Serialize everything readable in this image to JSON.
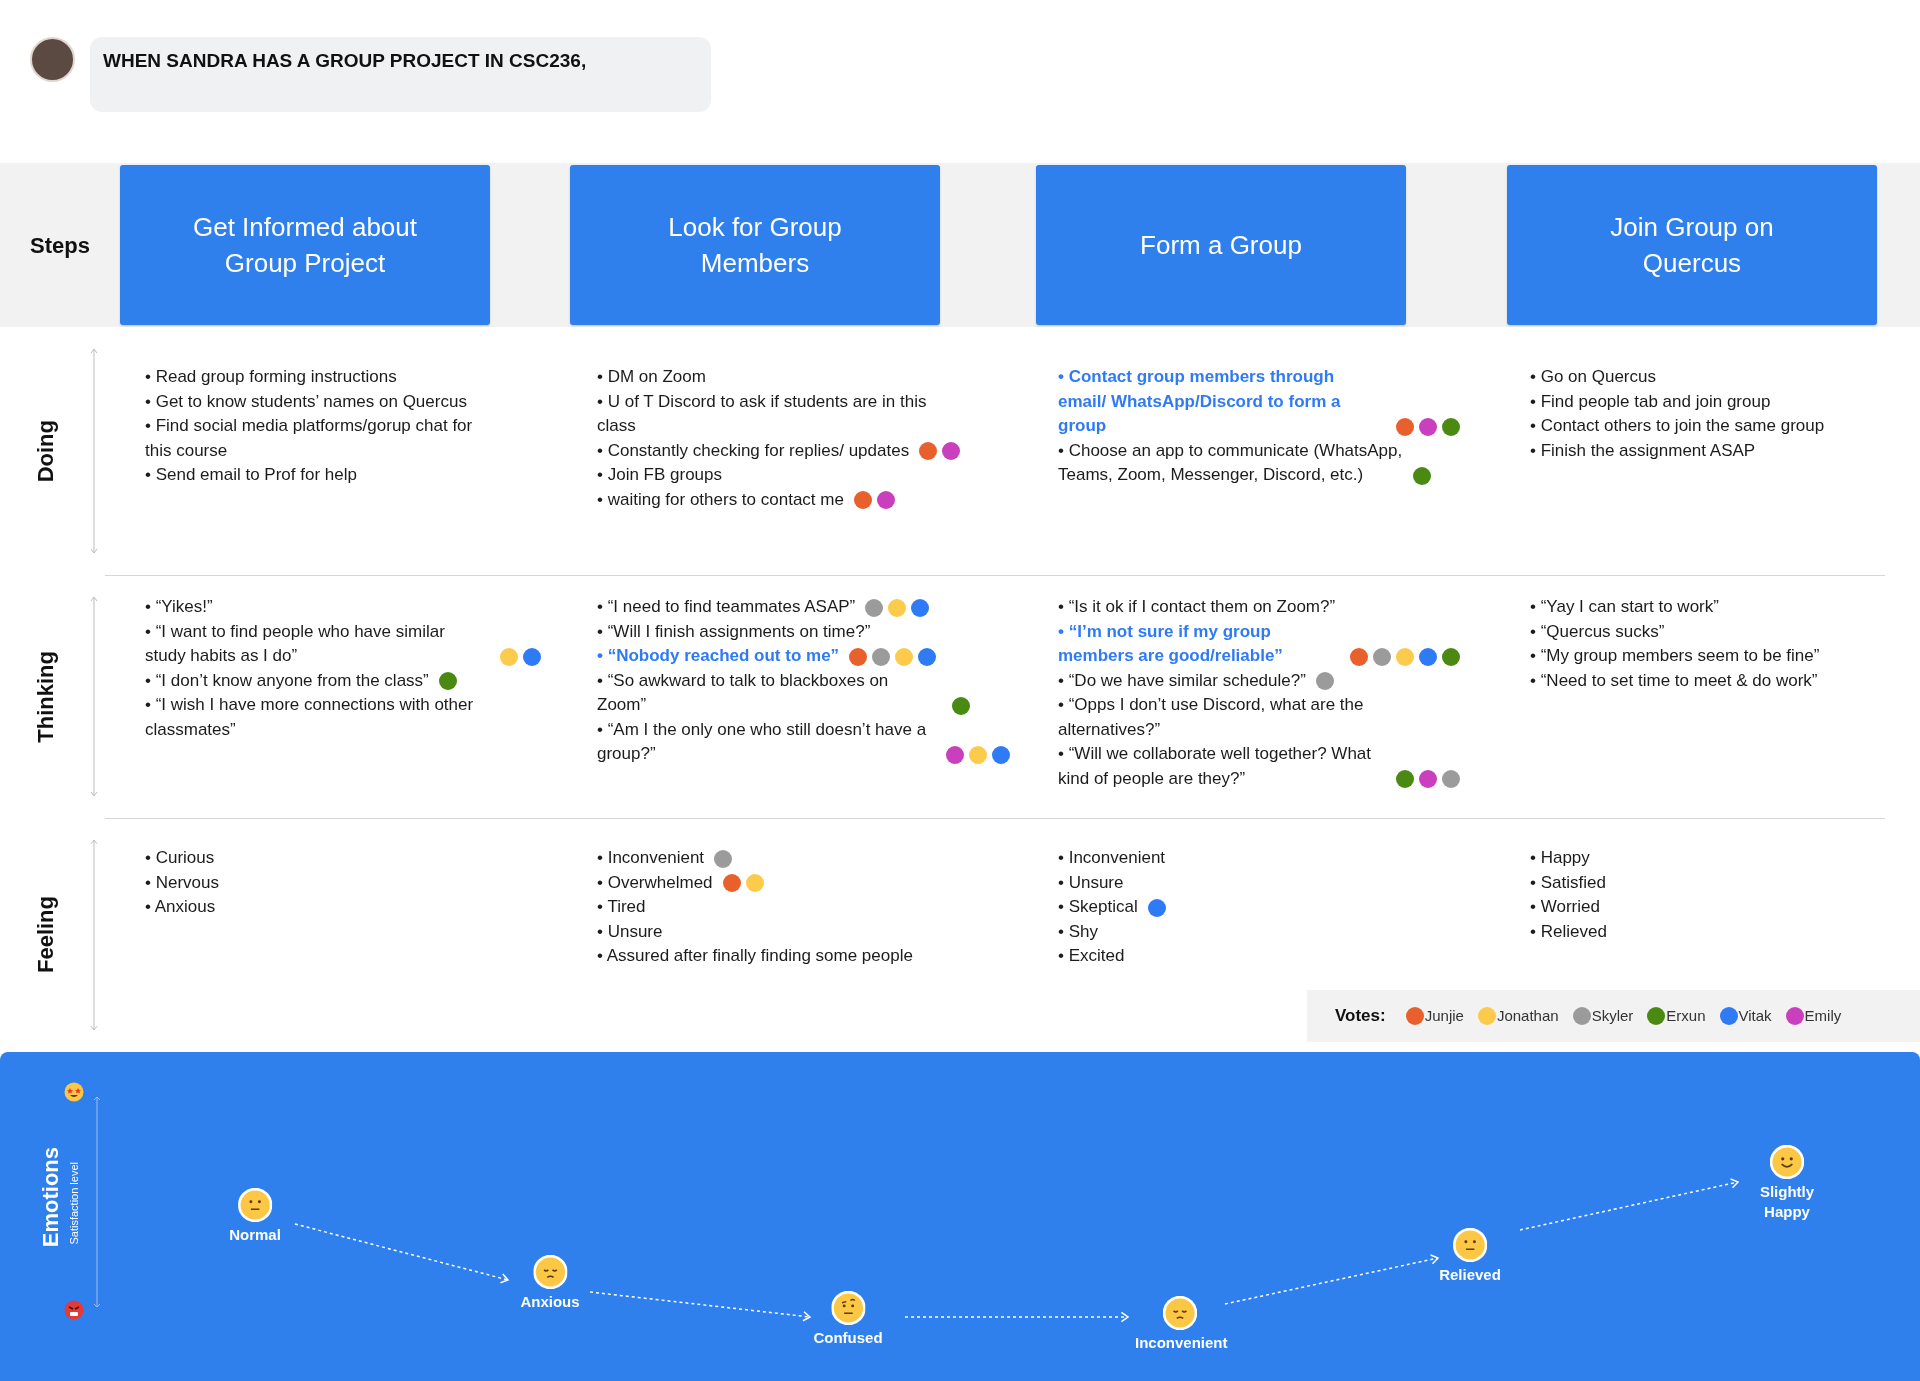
{
  "header": {
    "text": "WHEN SANDRA HAS A GROUP PROJECT IN CSC236,"
  },
  "bullet": "•",
  "steps": {
    "label": "Steps",
    "items": [
      "Get Informed about Group Project",
      "Look for Group Members",
      "Form a Group",
      "Join Group on Quercus"
    ]
  },
  "rows": [
    {
      "label": "Doing",
      "columns": [
        {
          "items": [
            {
              "text": "Read group forming instructions",
              "highlight": false
            },
            {
              "text": "Get to know students’ names on Quercus",
              "highlight": false
            },
            {
              "text": "Find social media platforms/gorup chat for this course",
              "highlight": false
            },
            {
              "text": "Send email to Prof for help",
              "highlight": false
            }
          ]
        },
        {
          "items": [
            {
              "text": "DM on Zoom",
              "highlight": false
            },
            {
              "text": "U of T Discord to ask if students are in this class",
              "highlight": false
            },
            {
              "text": "Constantly checking for replies/ updates",
              "highlight": false,
              "votes": [
                {
                  "color": "#e8602c"
                },
                {
                  "color": "#c93fbd"
                }
              ]
            },
            {
              "text": "Join FB groups",
              "highlight": false
            },
            {
              "text": "waiting for others to contact me",
              "highlight": false,
              "votes": [
                {
                  "color": "#e8602c"
                },
                {
                  "color": "#c93fbd"
                }
              ]
            }
          ]
        },
        {
          "items": [
            {
              "text": "Contact group members through email/ WhatsApp/Discord to form a group",
              "highlight": true,
              "votes": [
                {
                  "color": "#e8602c"
                },
                {
                  "color": "#c93fbd"
                },
                {
                  "color": "#4a8a12"
                }
              ]
            },
            {
              "text": "Choose an app to communicate (WhatsApp, Teams, Zoom, Messenger, Discord, etc.)",
              "highlight": false,
              "votes": [
                {
                  "color": "#4a8a12"
                }
              ]
            }
          ]
        },
        {
          "items": [
            {
              "text": "Go on Quercus",
              "highlight": false
            },
            {
              "text": "Find people tab and join group",
              "highlight": false
            },
            {
              "text": "Contact others to join the same group",
              "highlight": false
            },
            {
              "text": "Finish the assignment ASAP",
              "highlight": false
            }
          ]
        }
      ]
    },
    {
      "label": "Thinking",
      "columns": [
        {
          "items": [
            {
              "text": "“Yikes!”",
              "highlight": false
            },
            {
              "text": "“I want to find people who have similar study habits as I do”",
              "highlight": false,
              "votes": [
                {
                  "color": "#fdcb4b"
                },
                {
                  "color": "#2f7af5"
                }
              ]
            },
            {
              "text": "“I don’t know anyone from the class”",
              "highlight": false,
              "votes": [
                {
                  "color": "#4a8a12"
                }
              ]
            },
            {
              "text": "“I wish I have more connections with other classmates”",
              "highlight": false
            }
          ]
        },
        {
          "items": [
            {
              "text": "“I need to find teammates ASAP”",
              "highlight": false,
              "votes": [
                {
                  "color": "#9b9b9b"
                },
                {
                  "color": "#fdcb4b"
                },
                {
                  "color": "#2f7af5"
                }
              ]
            },
            {
              "text": "“Will I finish assignments on time?”",
              "highlight": false
            },
            {
              "text": "“Nobody reached out to me”",
              "highlight": true,
              "votes": [
                {
                  "color": "#e8602c"
                },
                {
                  "color": "#9b9b9b"
                },
                {
                  "color": "#fdcb4b"
                },
                {
                  "color": "#2f7af5"
                }
              ]
            },
            {
              "text": "“So awkward to talk to blackboxes on Zoom”",
              "highlight": false,
              "votes": [
                {
                  "color": "#4a8a12"
                }
              ]
            },
            {
              "text": "“Am I the only one who still doesn’t have a group?”",
              "highlight": false,
              "votes": [
                {
                  "color": "#c93fbd"
                },
                {
                  "color": "#fdcb4b"
                },
                {
                  "color": "#2f7af5"
                }
              ]
            }
          ]
        },
        {
          "items": [
            {
              "text": "“Is it ok if I contact them on Zoom?”",
              "highlight": false
            },
            {
              "text": "“I’m not sure if my group members are good/reliable”",
              "highlight": true,
              "votes": [
                {
                  "color": "#e8602c"
                },
                {
                  "color": "#9b9b9b"
                },
                {
                  "color": "#fdcb4b"
                },
                {
                  "color": "#2f7af5"
                },
                {
                  "color": "#4a8a12"
                }
              ]
            },
            {
              "text": "“Do we have similar schedule?”",
              "highlight": false,
              "votes": [
                {
                  "color": "#9b9b9b"
                }
              ]
            },
            {
              "text": "“Opps I don’t use Discord, what are the alternatives?”",
              "highlight": false
            },
            {
              "text": "“Will we collaborate well together? What kind of people are they?”",
              "highlight": false,
              "votes": [
                {
                  "color": "#4a8a12"
                },
                {
                  "color": "#c93fbd"
                },
                {
                  "color": "#9b9b9b"
                }
              ]
            }
          ]
        },
        {
          "items": [
            {
              "text": "“Yay I can start to work”",
              "highlight": false
            },
            {
              "text": "“Quercus sucks”",
              "highlight": false
            },
            {
              "text": "“My group members seem to be fine”",
              "highlight": false
            },
            {
              "text": "“Need to set time to meet & do work”",
              "highlight": false
            }
          ]
        }
      ]
    },
    {
      "label": "Feeling",
      "columns": [
        {
          "items": [
            {
              "text": "Curious",
              "highlight": false
            },
            {
              "text": "Nervous",
              "highlight": false
            },
            {
              "text": "Anxious",
              "highlight": false
            }
          ]
        },
        {
          "items": [
            {
              "text": "Inconvenient",
              "highlight": false,
              "votes": [
                {
                  "color": "#9b9b9b"
                }
              ]
            },
            {
              "text": "Overwhelmed",
              "highlight": false,
              "votes": [
                {
                  "color": "#e8602c"
                },
                {
                  "color": "#fdcb4b"
                }
              ]
            },
            {
              "text": "Tired",
              "highlight": false
            },
            {
              "text": "Unsure",
              "highlight": false
            },
            {
              "text": "Assured after finally finding some people",
              "highlight": false
            }
          ]
        },
        {
          "items": [
            {
              "text": "Inconvenient",
              "highlight": false
            },
            {
              "text": "Unsure",
              "highlight": false
            },
            {
              "text": "Skeptical",
              "highlight": false,
              "votes": [
                {
                  "color": "#2f7af5"
                }
              ]
            },
            {
              "text": "Shy",
              "highlight": false
            },
            {
              "text": "Excited",
              "highlight": false
            }
          ]
        },
        {
          "items": [
            {
              "text": "Happy",
              "highlight": false
            },
            {
              "text": "Satisfied",
              "highlight": false
            },
            {
              "text": "Worried",
              "highlight": false
            },
            {
              "text": "Relieved",
              "highlight": false
            }
          ]
        }
      ]
    }
  ],
  "votes_legend": {
    "label": "Votes:",
    "voters": [
      {
        "name": "Junjie",
        "color": "#e8602c"
      },
      {
        "name": "Jonathan",
        "color": "#fdcb4b"
      },
      {
        "name": "Skyler",
        "color": "#9b9b9b"
      },
      {
        "name": "Erxun",
        "color": "#4a8a12"
      },
      {
        "name": "Vitak",
        "color": "#2f7af5"
      },
      {
        "name": "Emily",
        "color": "#c93fbd"
      }
    ]
  },
  "emotions": {
    "title": "Emotions",
    "axis_label": "Satisfaction level",
    "points": [
      {
        "label": "Normal",
        "kind": "neutral"
      },
      {
        "label": "Anxious",
        "kind": "pensive"
      },
      {
        "label": "Confused",
        "kind": "raised-eyebrow"
      },
      {
        "label": "Inconvenient",
        "kind": "pensive"
      },
      {
        "label": "Relieved",
        "kind": "neutral"
      },
      {
        "label": "Slightly Happy",
        "kind": "smile"
      }
    ]
  }
}
